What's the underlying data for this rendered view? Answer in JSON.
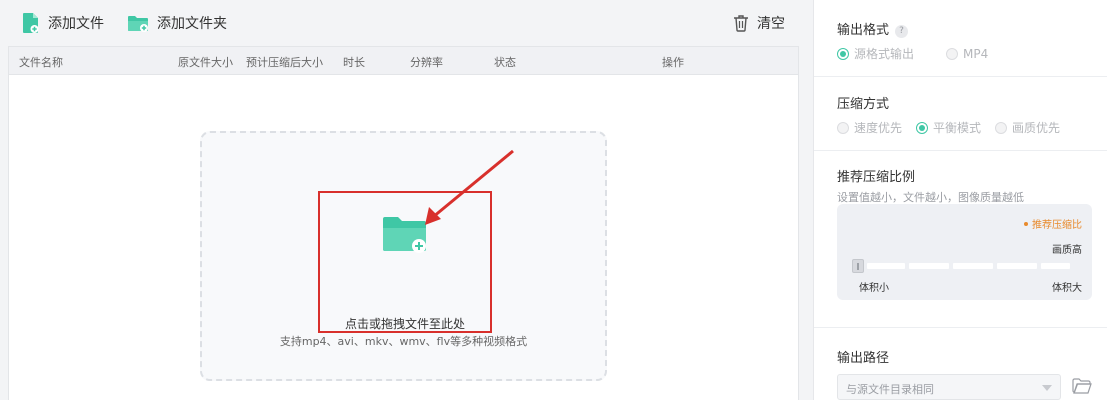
{
  "toolbar": {
    "add_file": "添加文件",
    "add_folder": "添加文件夹",
    "clear": "清空"
  },
  "table": {
    "columns": [
      "文件名称",
      "原文件大小",
      "预计压缩后大小",
      "时长",
      "分辨率",
      "状态",
      "操作"
    ]
  },
  "dropzone": {
    "title": "点击或拖拽文件至此处",
    "subtitle": "支持mp4、avi、mkv、wmv、flv等多种视频格式"
  },
  "settings": {
    "output_format": {
      "title": "输出格式",
      "help": "?",
      "options": [
        {
          "label": "源格式输出",
          "checked": true
        },
        {
          "label": "MP4",
          "checked": false
        }
      ]
    },
    "compress_mode": {
      "title": "压缩方式",
      "options": [
        {
          "label": "速度优先",
          "checked": false
        },
        {
          "label": "平衡模式",
          "checked": true
        },
        {
          "label": "画质优先",
          "checked": false
        }
      ]
    },
    "ratio": {
      "title": "推荐压缩比例",
      "hint": "设置值越小，文件越小，图像质量越低",
      "recommend": "推荐压缩比",
      "quality_high": "画质高",
      "volume_small": "体积小",
      "volume_large": "体积大",
      "level": 0
    },
    "output_path": {
      "title": "输出路径",
      "value": "与源文件目录相同"
    }
  },
  "colors": {
    "accent": "#3fc7a5",
    "highlight": "#d8302c",
    "recommend": "#e88a2c"
  }
}
